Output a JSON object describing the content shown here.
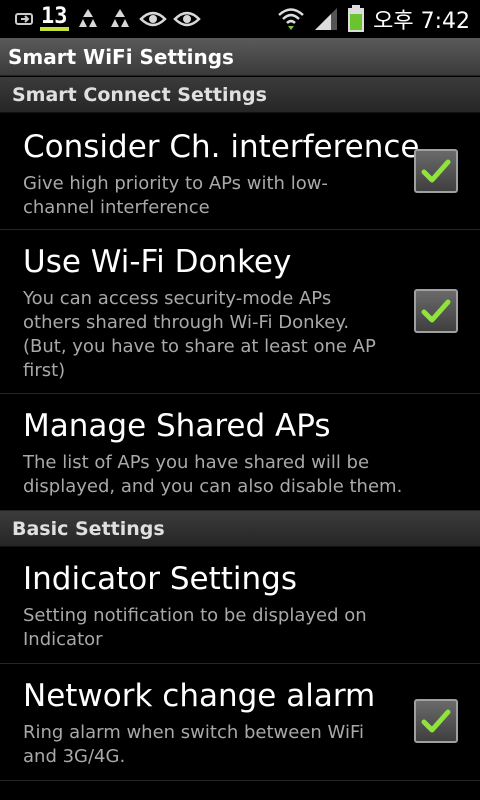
{
  "status_bar": {
    "notif_badge": "13",
    "time": "오후 7:42",
    "icons": [
      "usb-icon",
      "recycle-icon",
      "recycle-icon",
      "eye-icon",
      "eye-icon",
      "wifi-icon",
      "signal-icon",
      "battery-icon"
    ]
  },
  "header": {
    "title": "Smart WiFi Settings"
  },
  "sections": [
    {
      "header": "Smart Connect Settings"
    },
    {
      "header": "Basic Settings"
    }
  ],
  "items": [
    {
      "title": "Consider Ch. interference",
      "summary": "Give high priority to APs with low-channel interference",
      "checked": true
    },
    {
      "title": "Use Wi-Fi Donkey",
      "summary": "You can access security-mode APs others shared through Wi-Fi Donkey. (But, you have to share at least one AP first)",
      "checked": true
    },
    {
      "title": "Manage Shared APs",
      "summary": "The list of APs you have shared will be displayed, and you can also disable them."
    },
    {
      "title": "Indicator Settings",
      "summary": "Setting notification to be displayed on Indicator"
    },
    {
      "title": "Network change alarm",
      "summary": "Ring alarm when switch between WiFi and 3G/4G.",
      "checked": true
    }
  ],
  "colors": {
    "check": "#8fe33a",
    "accent_bar": "#c8e23c"
  }
}
